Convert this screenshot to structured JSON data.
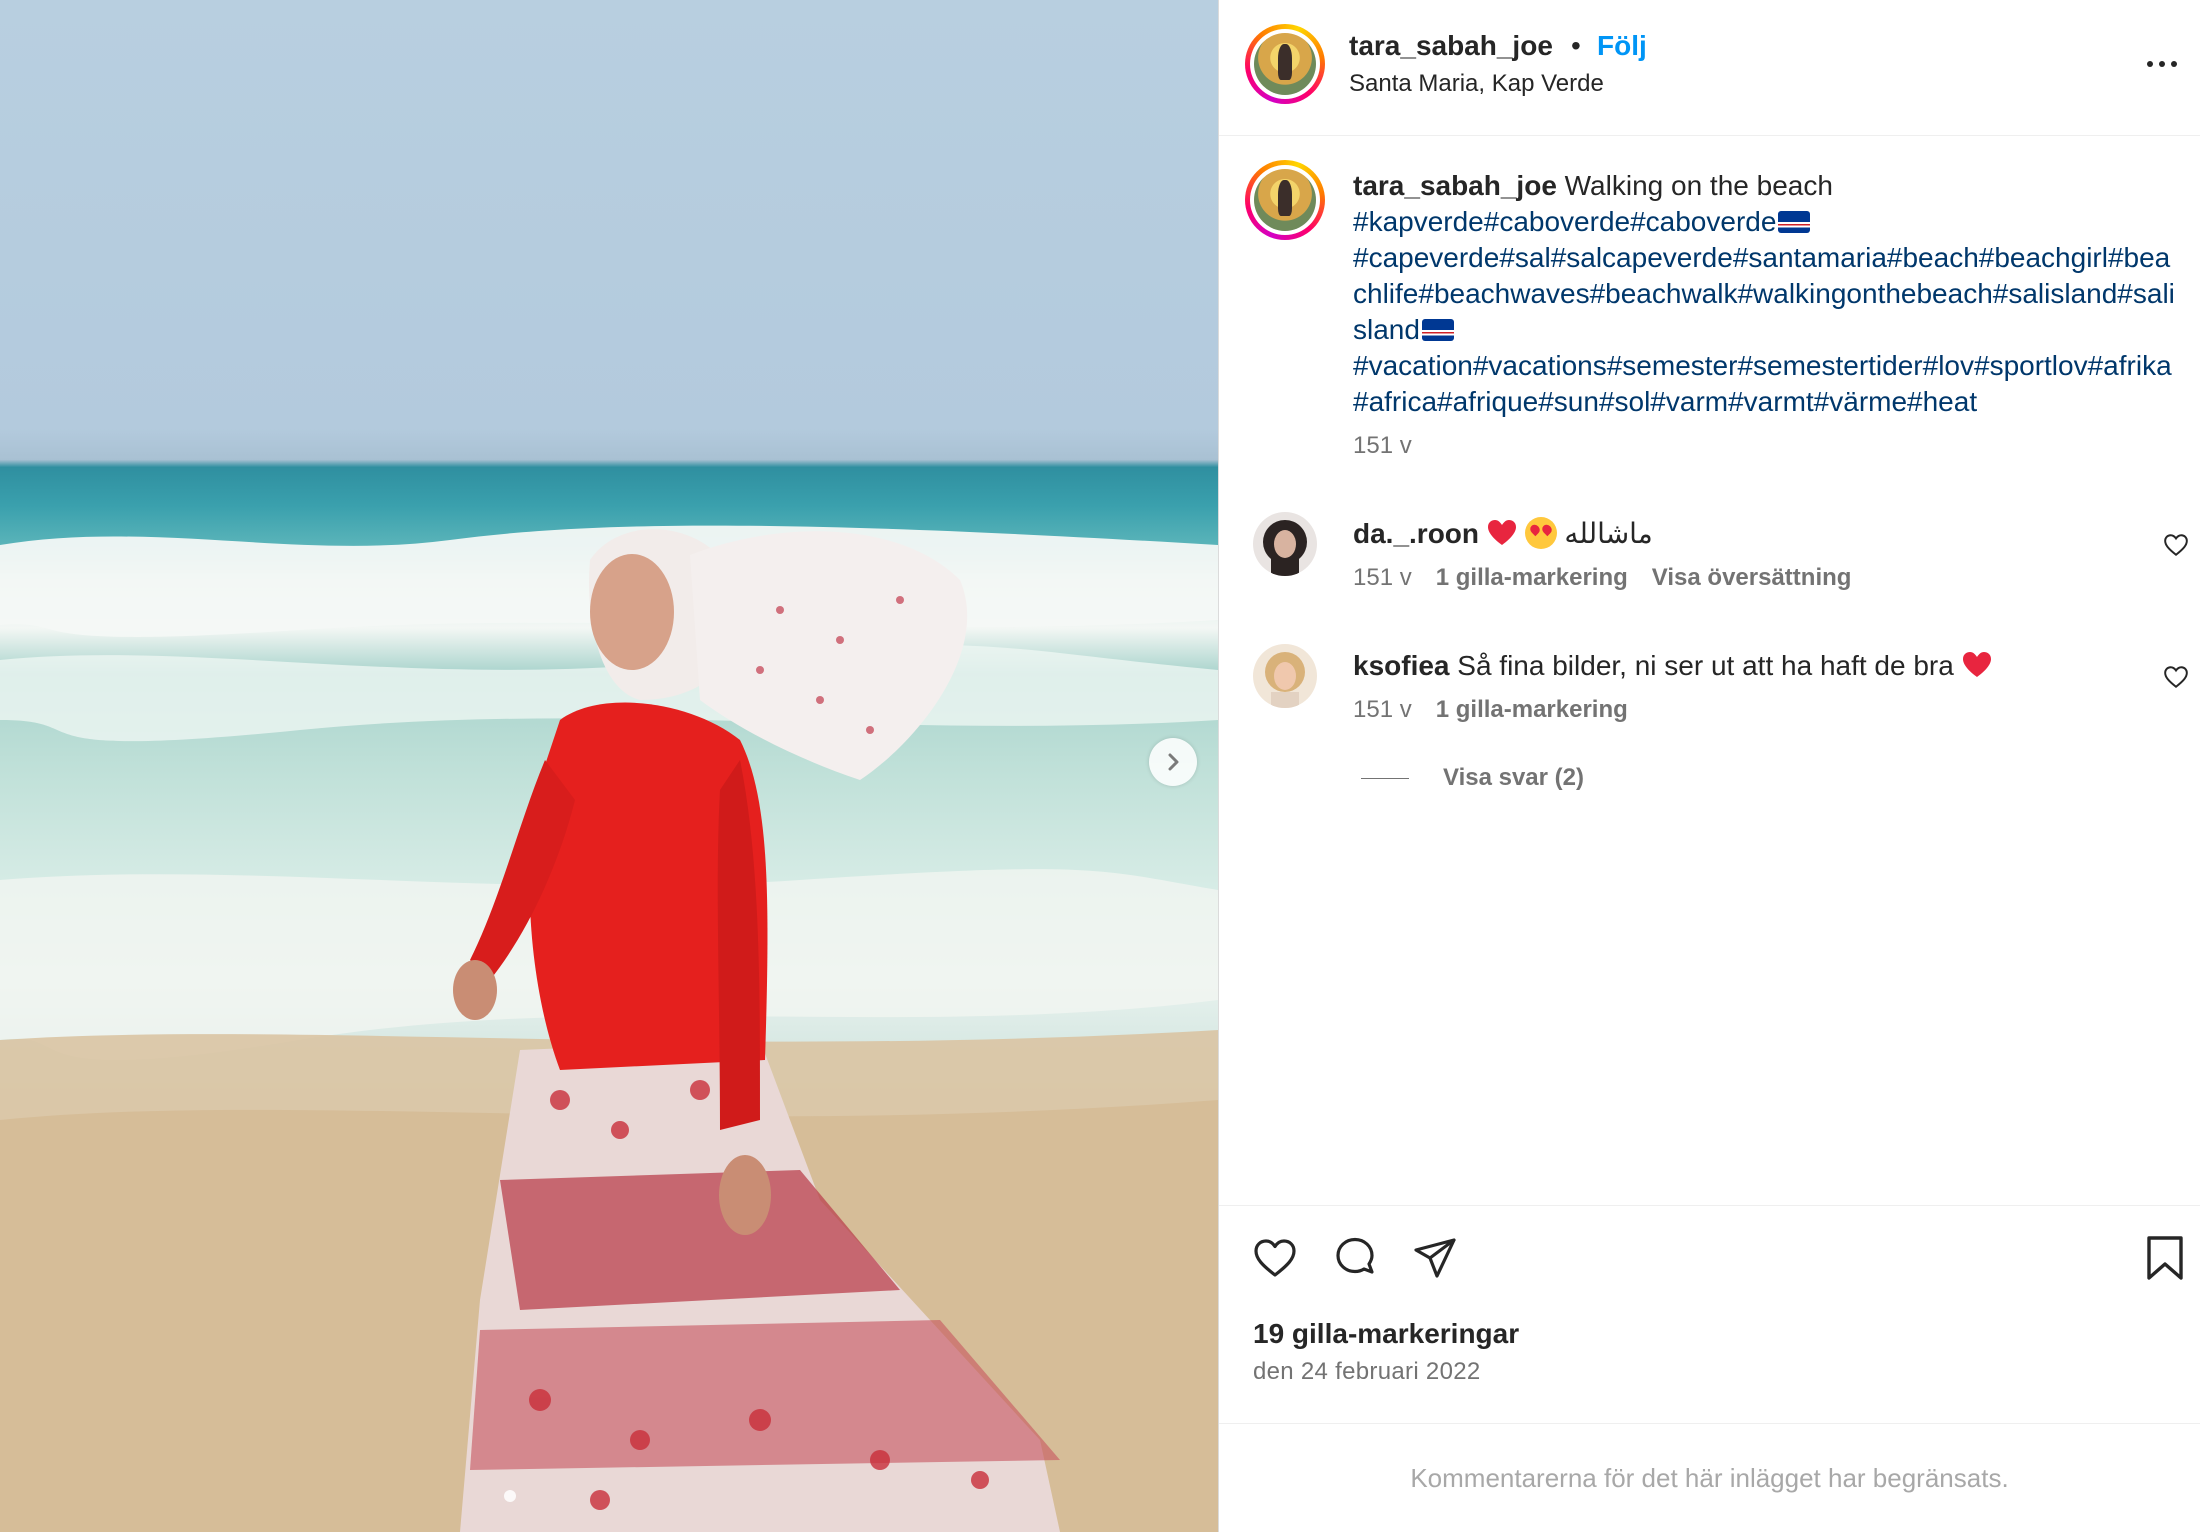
{
  "post": {
    "username": "tara_sabah_joe",
    "follow_label": "Följ",
    "separator": "•",
    "location": "Santa Maria, Kap Verde"
  },
  "caption": {
    "username": "tara_sabah_joe",
    "text": "Walking on the beach",
    "tags_line1": "#kapverde#caboverde#caboverde",
    "tags_line2": "#capeverde#sal#salcapeverde#santamaria#beach#beachgirl#beachlife#beachwaves#beachwalk#walkingonthebeach#salisland#salisland",
    "tags_line3": "#vacation#vacations#semester#semestertider#lov#sportlov#afrika#africa#afrique#sun#sol#varm#varmt#värme#heat",
    "time": "151 v"
  },
  "comments": [
    {
      "username": "da._.roon",
      "text": "ماشالله",
      "time": "151 v",
      "likes": "1 gilla-markering",
      "translate": "Visa översättning"
    },
    {
      "username": "ksofiea",
      "text": "Så fina bilder, ni ser ut att ha haft de bra",
      "time": "151 v",
      "likes": "1 gilla-markering"
    }
  ],
  "replies_label": "Visa svar (2)",
  "likes_count": "19 gilla-markeringar",
  "date": "den 24 februari 2022",
  "comments_limited": "Kommentarerna för det här inlägget har begränsats.",
  "colors": {
    "link": "#0095f6",
    "hashtag": "#00376b",
    "secondary_text": "#737373",
    "heart_emoji": "#e8253f"
  },
  "icons": [
    "more-options-icon",
    "carousel-next-icon",
    "heart-icon",
    "comment-icon",
    "share-icon",
    "bookmark-icon",
    "small-heart-icon",
    "flag-cape-verde-icon"
  ]
}
